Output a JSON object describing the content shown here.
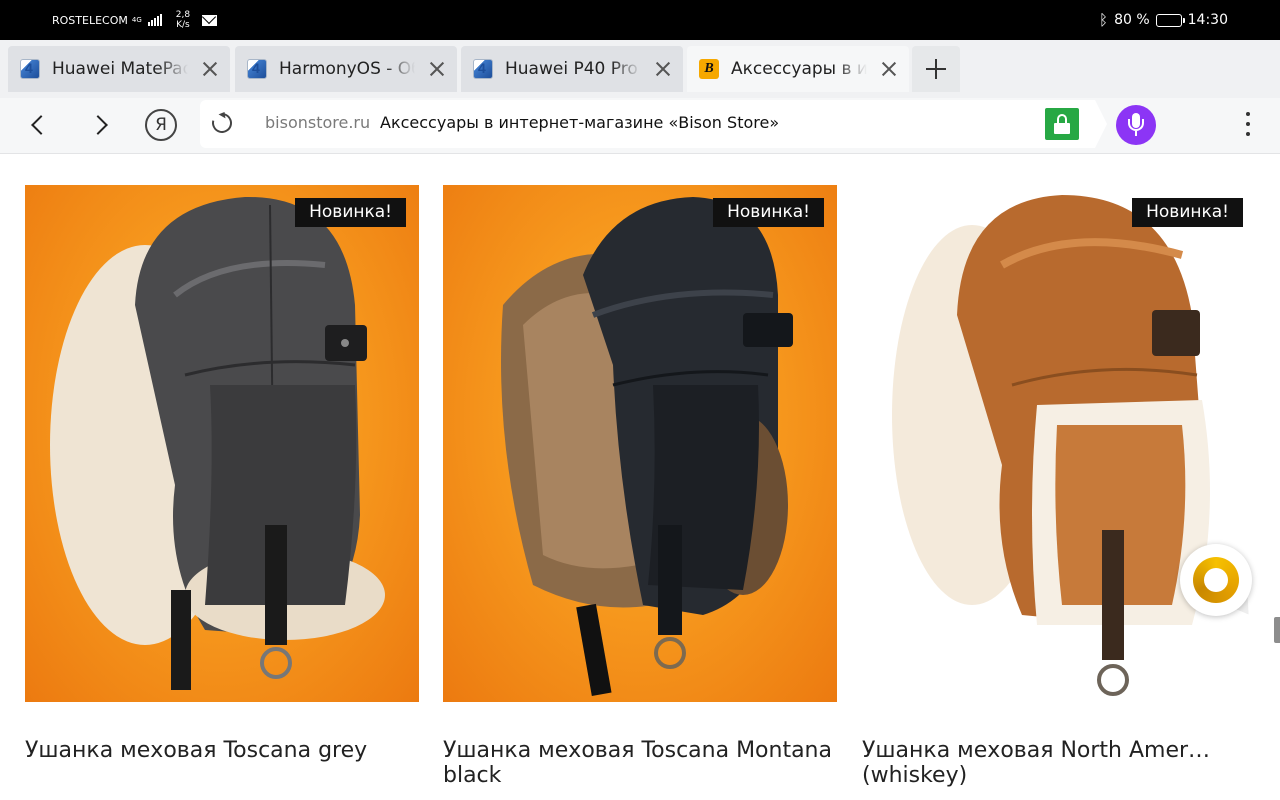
{
  "status_bar": {
    "carrier": "ROSTELECOM",
    "network": "4G",
    "speed_value": "2,8",
    "speed_unit": "K/s",
    "battery": "80 %",
    "battery_level": 0.8,
    "time": "14:30",
    "icons": [
      "signal-icon",
      "mail-icon",
      "bluetooth-icon",
      "battery-icon"
    ]
  },
  "tabs": [
    {
      "title": "Huawei MatePad",
      "favicon": "site-4pda-icon",
      "active": false
    },
    {
      "title": "HarmonyOS - Об",
      "favicon": "site-4pda-icon",
      "active": false
    },
    {
      "title": "Huawei P40 Pro -",
      "favicon": "site-4pda-icon",
      "active": false
    },
    {
      "title": "Аксессуары в ин",
      "favicon": "bison-favicon-icon",
      "active": true
    }
  ],
  "favicon_letter": "B",
  "toolbar": {
    "domain": "bisonstore.ru",
    "page_title": "Аксессуары в интернет-магазине «Bison Store»",
    "ya_label": "Я",
    "colors": {
      "lock_badge": "#27a844",
      "mic": "#8c35f5"
    }
  },
  "products": [
    {
      "name": "Ушанка меховая Toscana grey",
      "badge": "Новинка!",
      "image": "grey leather ushanka hat with cream fur on orange background"
    },
    {
      "name": "Ушанка меховая Toscana Montana black",
      "badge": "Новинка!",
      "image": "black leather ushanka hat with brown fur on orange background"
    },
    {
      "name": "Ушанка меховая North Amer… (whiskey)",
      "badge": "Новинка!",
      "image": "whiskey brown suede ushanka hat with white sheepskin on white background"
    }
  ],
  "colors": {
    "badge_bg": "#111111",
    "accent_orange": "#f79a1e"
  }
}
